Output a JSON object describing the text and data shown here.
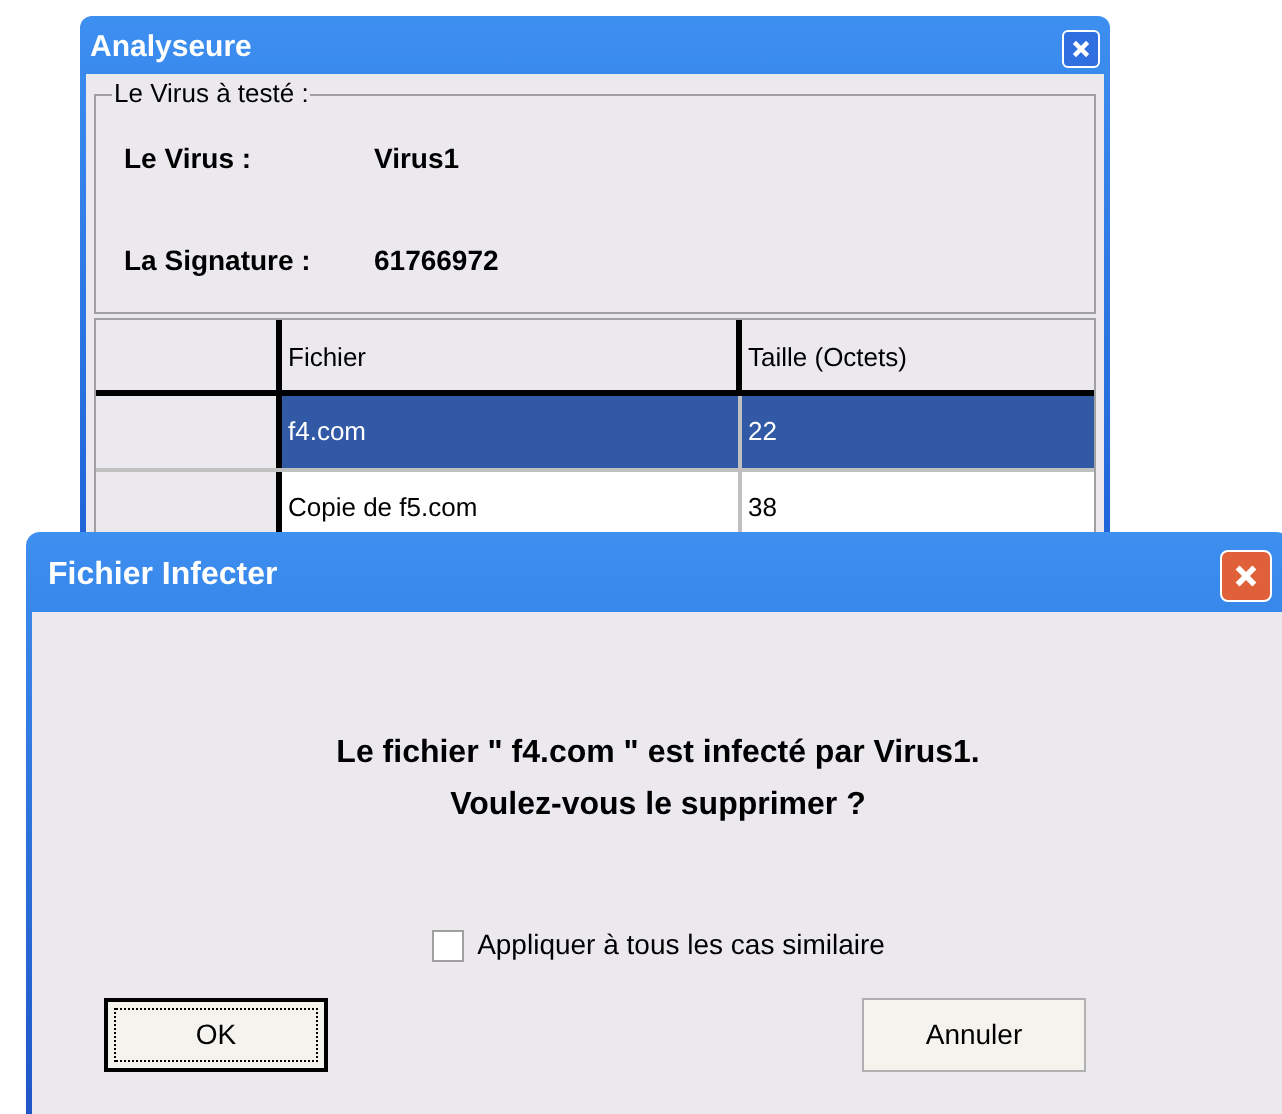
{
  "main_window": {
    "title": "Analyseure",
    "group": {
      "legend": "Le Virus à testé :",
      "fields": [
        {
          "label": "Le Virus :",
          "value": "Virus1"
        },
        {
          "label": "La Signature :",
          "value": "61766972"
        }
      ]
    },
    "table": {
      "columns": [
        "Fichier",
        "Taille (Octets)"
      ],
      "rows": [
        {
          "cells": [
            "f4.com",
            "22"
          ],
          "selected": true
        },
        {
          "cells": [
            "Copie de f5.com",
            "38"
          ],
          "selected": false
        }
      ]
    }
  },
  "dialog": {
    "title": "Fichier Infecter",
    "message_lines": [
      "Le fichier \" f4.com \" est infecté par Virus1.",
      "Voulez-vous le supprimer ?"
    ],
    "checkbox": {
      "label": "Appliquer à tous les cas similaire",
      "checked": false
    },
    "buttons": [
      {
        "label": "OK",
        "default": true
      },
      {
        "label": "Annuler",
        "default": false
      }
    ]
  }
}
